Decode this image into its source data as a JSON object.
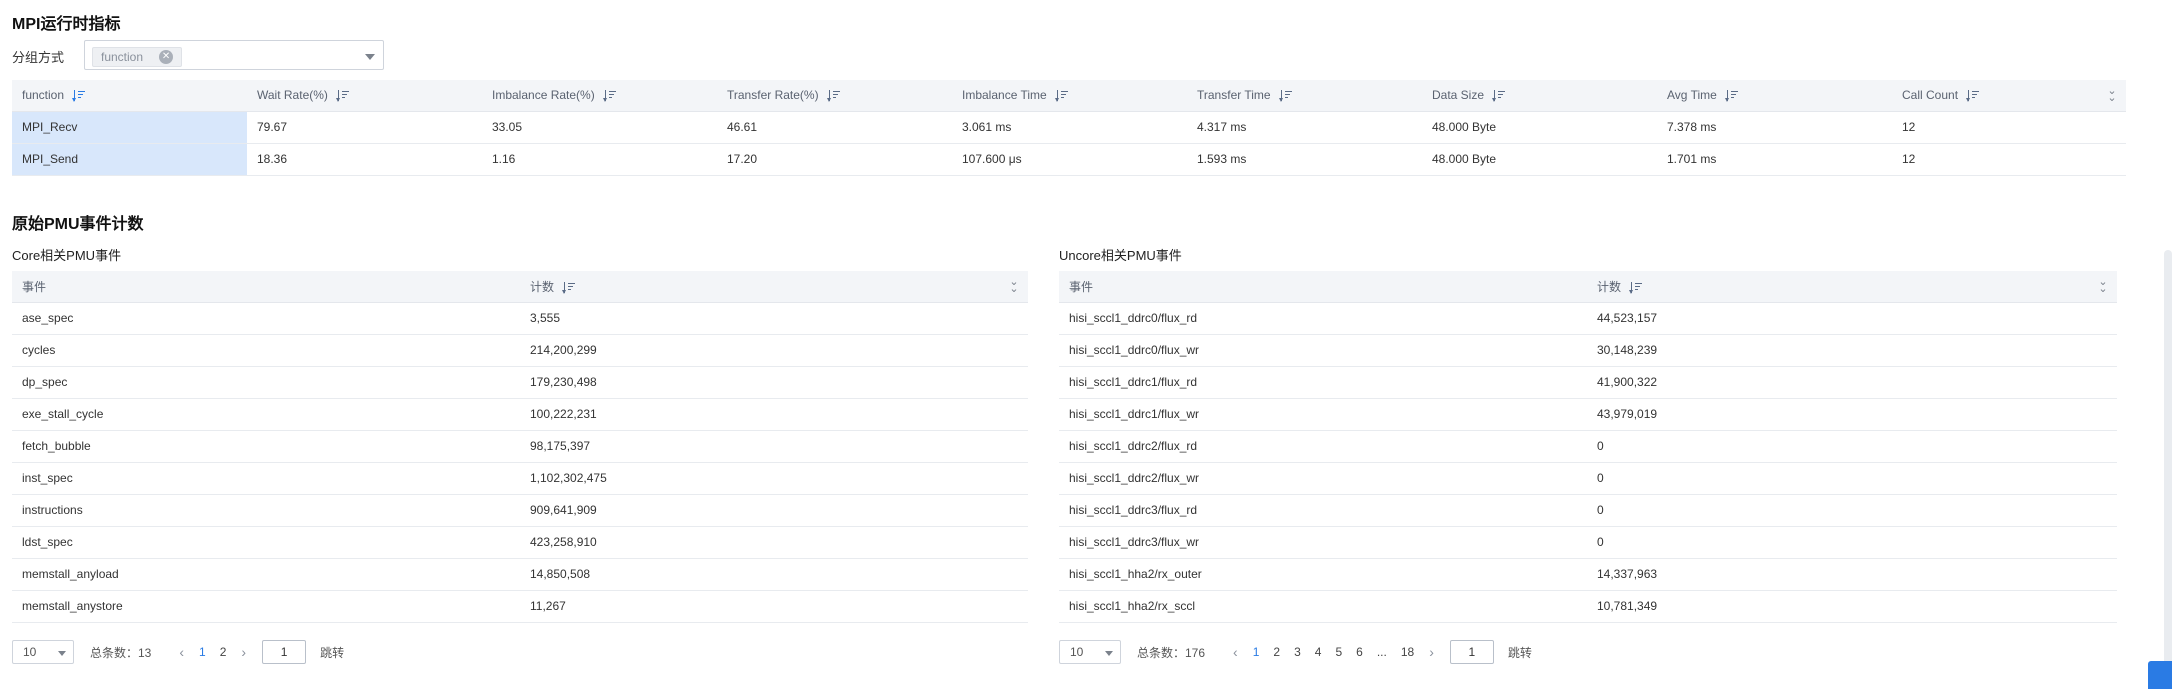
{
  "mpi": {
    "title": "MPI运行时指标",
    "group_label": "分组方式",
    "group_tag": "function",
    "columns": [
      "function",
      "Wait Rate(%)",
      "Imbalance Rate(%)",
      "Transfer Rate(%)",
      "Imbalance Time",
      "Transfer Time",
      "Data Size",
      "Avg Time",
      "Call Count"
    ],
    "rows": [
      [
        "MPI_Recv",
        "79.67",
        "33.05",
        "46.61",
        "3.061 ms",
        "4.317 ms",
        "48.000 Byte",
        "7.378 ms",
        "12"
      ],
      [
        "MPI_Send",
        "18.36",
        "1.16",
        "17.20",
        "107.600 μs",
        "1.593 ms",
        "48.000 Byte",
        "1.701 ms",
        "12"
      ]
    ]
  },
  "pmu": {
    "title": "原始PMU事件计数",
    "core": {
      "label": "Core相关PMU事件",
      "columns": [
        "事件",
        "计数"
      ],
      "rows": [
        [
          "ase_spec",
          "3,555"
        ],
        [
          "cycles",
          "214,200,299"
        ],
        [
          "dp_spec",
          "179,230,498"
        ],
        [
          "exe_stall_cycle",
          "100,222,231"
        ],
        [
          "fetch_bubble",
          "98,175,397"
        ],
        [
          "inst_spec",
          "1,102,302,475"
        ],
        [
          "instructions",
          "909,641,909"
        ],
        [
          "ldst_spec",
          "423,258,910"
        ],
        [
          "memstall_anyload",
          "14,850,508"
        ],
        [
          "memstall_anystore",
          "11,267"
        ]
      ],
      "pager": {
        "size": "10",
        "total": "总条数：13",
        "prev": "‹",
        "next": "›",
        "pages": [
          "1",
          "2"
        ],
        "active": "1",
        "jump_value": "1",
        "jump_label": "跳转"
      }
    },
    "uncore": {
      "label": "Uncore相关PMU事件",
      "columns": [
        "事件",
        "计数"
      ],
      "rows": [
        [
          "hisi_sccl1_ddrc0/flux_rd",
          "44,523,157"
        ],
        [
          "hisi_sccl1_ddrc0/flux_wr",
          "30,148,239"
        ],
        [
          "hisi_sccl1_ddrc1/flux_rd",
          "41,900,322"
        ],
        [
          "hisi_sccl1_ddrc1/flux_wr",
          "43,979,019"
        ],
        [
          "hisi_sccl1_ddrc2/flux_rd",
          "0"
        ],
        [
          "hisi_sccl1_ddrc2/flux_wr",
          "0"
        ],
        [
          "hisi_sccl1_ddrc3/flux_rd",
          "0"
        ],
        [
          "hisi_sccl1_ddrc3/flux_wr",
          "0"
        ],
        [
          "hisi_sccl1_hha2/rx_outer",
          "14,337,963"
        ],
        [
          "hisi_sccl1_hha2/rx_sccl",
          "10,781,349"
        ]
      ],
      "pager": {
        "size": "10",
        "total": "总条数：176",
        "prev": "‹",
        "next": "›",
        "pages": [
          "1",
          "2",
          "3",
          "4",
          "5",
          "6",
          "...",
          "18"
        ],
        "active": "1",
        "jump_value": "1",
        "jump_label": "跳转"
      }
    }
  },
  "colors": {
    "accent": "#2a7be4",
    "highlight_cell": "#d8e7fb",
    "header_bg": "#f3f5f8"
  }
}
